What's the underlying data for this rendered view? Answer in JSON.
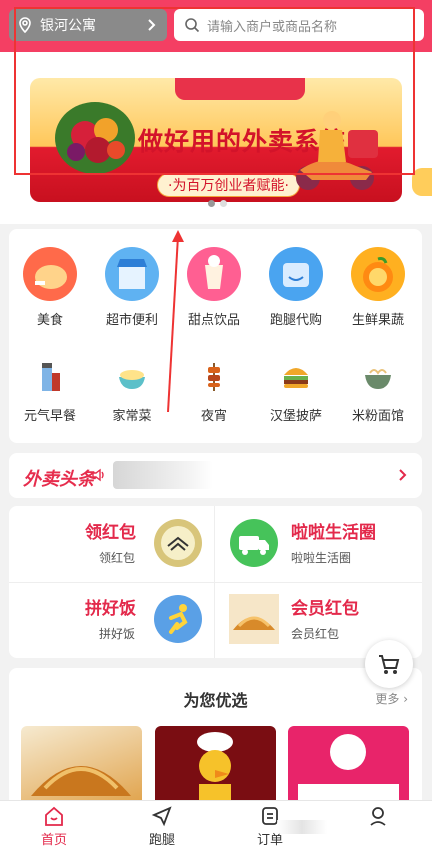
{
  "header": {
    "location": "银河公寓",
    "search_placeholder": "请输入商户或商品名称"
  },
  "banner": {
    "title": "做好用的外卖系统",
    "subtitle": "·为百万创业者赋能·"
  },
  "categories": [
    {
      "label": "美食",
      "icon": "chicken-leg-icon"
    },
    {
      "label": "超市便利",
      "icon": "store-icon"
    },
    {
      "label": "甜点饮品",
      "icon": "bubble-tea-icon"
    },
    {
      "label": "跑腿代购",
      "icon": "delivery-box-icon"
    },
    {
      "label": "生鲜果蔬",
      "icon": "orange-icon"
    },
    {
      "label": "元气早餐",
      "icon": "milk-bottle-icon"
    },
    {
      "label": "家常菜",
      "icon": "rice-bowl-icon"
    },
    {
      "label": "夜宵",
      "icon": "skewer-icon"
    },
    {
      "label": "汉堡披萨",
      "icon": "burger-icon"
    },
    {
      "label": "米粉面馆",
      "icon": "noodle-bowl-icon"
    }
  ],
  "headlines": {
    "logo": "外卖头条"
  },
  "promos": [
    {
      "title": "领红包",
      "subtitle": "领红包",
      "icon": "red-envelope-icon"
    },
    {
      "title": "啦啦生活圈",
      "subtitle": "啦啦生活圈",
      "icon": "truck-icon"
    },
    {
      "title": "拼好饭",
      "subtitle": "拼好饭",
      "icon": "runner-icon"
    },
    {
      "title": "会员红包",
      "subtitle": "会员红包",
      "icon": "bread-image"
    }
  ],
  "recommended": {
    "title": "为您优选",
    "more": "更多"
  },
  "nav": [
    {
      "label": "首页",
      "icon": "home-icon",
      "active": true
    },
    {
      "label": "跑腿",
      "icon": "send-icon",
      "active": false
    },
    {
      "label": "订单",
      "icon": "order-icon",
      "active": false
    },
    {
      "label": "",
      "icon": "user-icon",
      "active": false
    }
  ],
  "colors": {
    "brand": "#f43f63",
    "accent_text": "#e3294b"
  }
}
